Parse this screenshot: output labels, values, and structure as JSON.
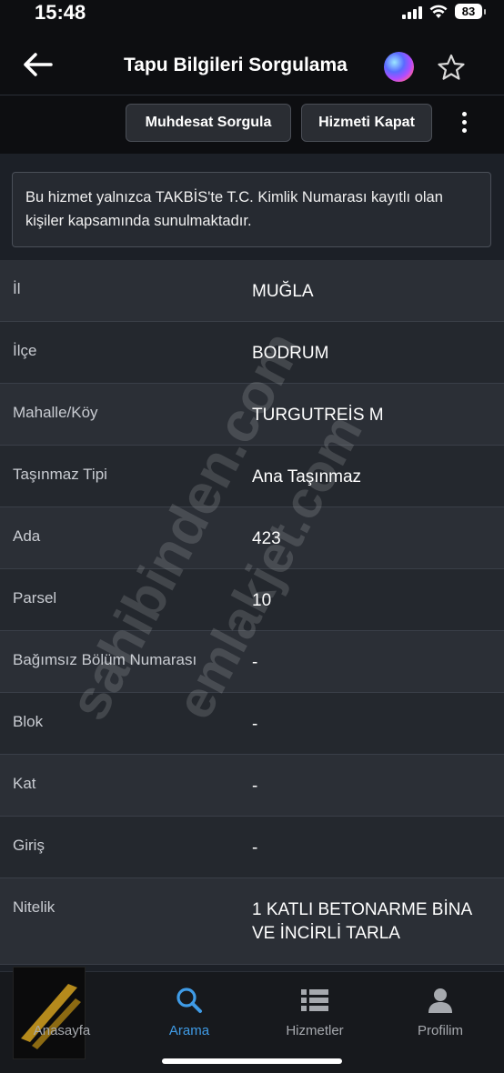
{
  "status_bar": {
    "time": "15:48",
    "battery": "83"
  },
  "header": {
    "title": "Tapu Bilgileri Sorgulama"
  },
  "toolbar": {
    "muhdesat_label": "Muhdesat Sorgula",
    "kapat_label": "Hizmeti Kapat"
  },
  "info": {
    "text": "Bu hizmet yalnızca TAKBİS'te T.C. Kimlik Numarası kayıtlı olan kişiler kapsamında sunulmaktadır."
  },
  "rows": [
    {
      "label": "İl",
      "value": "MUĞLA"
    },
    {
      "label": "İlçe",
      "value": "BODRUM"
    },
    {
      "label": "Mahalle/Köy",
      "value": "TURGUTREİS M"
    },
    {
      "label": "Taşınmaz Tipi",
      "value": "Ana Taşınmaz"
    },
    {
      "label": "Ada",
      "value": "423"
    },
    {
      "label": "Parsel",
      "value": "10"
    },
    {
      "label": "Bağımsız Bölüm Numarası",
      "value": "-"
    },
    {
      "label": "Blok",
      "value": "-"
    },
    {
      "label": "Kat",
      "value": "-"
    },
    {
      "label": "Giriş",
      "value": "-"
    },
    {
      "label": "Nitelik",
      "value": "1 KATLI BETONARME BİNA VE İNCİRLİ TARLA"
    }
  ],
  "watermarks": [
    "sahibinden.com",
    "emlakjet.com"
  ],
  "nav": {
    "home": "Anasayfa",
    "arama": "Arama",
    "hizmetler": "Hizmetler",
    "profil": "Profilim"
  },
  "colors": {
    "accent": "#3f9be6",
    "background": "#1c2027"
  }
}
